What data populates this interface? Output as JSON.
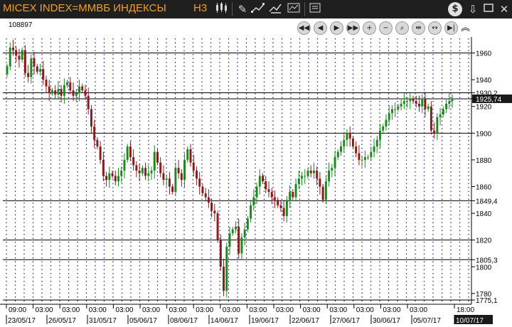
{
  "titlebar": {
    "title": "MICEX INDEX=ММВБ ИНДЕКСЫ",
    "timeframe": "H3"
  },
  "toolbar_icons": [
    "candlestick-icon",
    "line-icon",
    "pencil-icon",
    "draw-tools-icon",
    "indicators-icon",
    "separator",
    "list-icon",
    "dollar-icon",
    "download-icon",
    "maximize-icon",
    "close-icon"
  ],
  "nav_buttons": [
    "scroll-start-button",
    "scroll-left-button",
    "scroll-right-button",
    "scroll-end-button",
    "zoom-in-button",
    "zoom-out-button",
    "zoom-fit-button",
    "compress-button",
    "expand-button",
    "scroll-last-button",
    "collapse-button"
  ],
  "header": {
    "counter": "108897"
  },
  "chart_data": {
    "type": "candlestick",
    "title": "",
    "y_range": [
      1773,
      1972
    ],
    "y_ticks": [
      1780,
      1800,
      1820,
      1840,
      1860,
      1880,
      1900,
      1920,
      1940,
      1960
    ],
    "price_lines": [
      {
        "value": 1960,
        "label": "1960"
      },
      {
        "value": 1930.2,
        "label": "1930,2"
      },
      {
        "value": 1925.74,
        "label": "1925,74",
        "highlight": true
      },
      {
        "value": 1900,
        "label": "1900"
      },
      {
        "value": 1849.4,
        "label": "1849,4"
      },
      {
        "value": 1820,
        "label": "1820"
      },
      {
        "value": 1805.3,
        "label": "1805,3"
      },
      {
        "value": 1775.1,
        "label": "1775,1"
      }
    ],
    "time_labels_top": [
      "09:00",
      "03:00",
      "03:00",
      "03:00",
      "03:00",
      "03:00",
      "03:00",
      "03:00",
      "03:00",
      "03:00",
      "03:00",
      "03:00",
      "03:00",
      "03:00",
      "03:00",
      "03:00",
      "18:00"
    ],
    "date_labels": [
      "23/05/17",
      "26/05/17",
      "31/05/17",
      "05/06/17",
      "08/06/17",
      "14/06/17",
      "19/06/17",
      "22/06/17",
      "27/06/17",
      "30/06/17",
      "05/07/17",
      "10/07/17"
    ],
    "up_color": "#1a8a1a",
    "down_color": "#8b1a1a",
    "closes": [
      1950,
      1964,
      1962,
      1958,
      1955,
      1962,
      1945,
      1942,
      1956,
      1950,
      1946,
      1948,
      1940,
      1935,
      1930,
      1932,
      1929,
      1933,
      1928,
      1936,
      1938,
      1932,
      1928,
      1930,
      1935,
      1932,
      1928,
      1918,
      1905,
      1895,
      1890,
      1880,
      1868,
      1865,
      1870,
      1868,
      1864,
      1868,
      1872,
      1880,
      1890,
      1882,
      1876,
      1872,
      1870,
      1874,
      1868,
      1870,
      1872,
      1886,
      1878,
      1870,
      1865,
      1866,
      1860,
      1856,
      1874,
      1870,
      1865,
      1880,
      1888,
      1878,
      1872,
      1866,
      1860,
      1855,
      1852,
      1848,
      1842,
      1840,
      1820,
      1800,
      1782,
      1815,
      1825,
      1828,
      1830,
      1810,
      1822,
      1828,
      1836,
      1846,
      1852,
      1860,
      1868,
      1864,
      1858,
      1856,
      1852,
      1850,
      1846,
      1844,
      1838,
      1850,
      1856,
      1852,
      1862,
      1866,
      1868,
      1868,
      1872,
      1870,
      1872,
      1866,
      1860,
      1850,
      1864,
      1872,
      1874,
      1882,
      1886,
      1890,
      1895,
      1900,
      1896,
      1890,
      1885,
      1880,
      1880,
      1882,
      1882,
      1886,
      1890,
      1895,
      1902,
      1905,
      1910,
      1915,
      1918,
      1918,
      1920,
      1922,
      1924,
      1924,
      1926,
      1924,
      1922,
      1920,
      1926,
      1918,
      1920,
      1902,
      1900,
      1912,
      1914,
      1918,
      1922,
      1924,
      1926
    ]
  }
}
